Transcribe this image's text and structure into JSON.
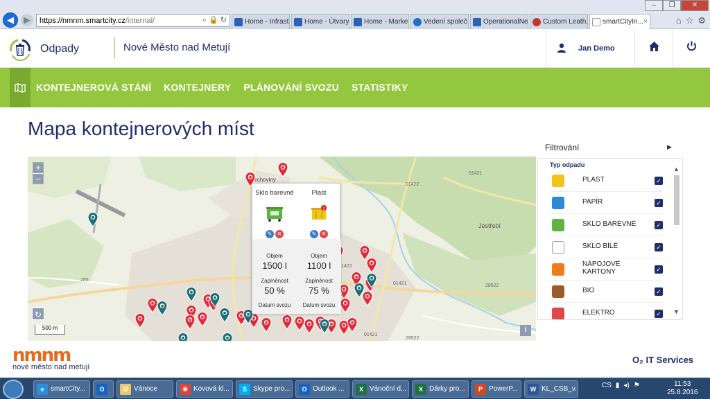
{
  "browser": {
    "url_domain": "https://nmnm.smartcity.cz",
    "url_path": "/internal/",
    "tabs": [
      {
        "label": "Home - Infrast...",
        "active": false
      },
      {
        "label": "Home - Útvary...",
        "active": false
      },
      {
        "label": "Home - Marke...",
        "active": false
      },
      {
        "label": "Vedení společ...",
        "active": false
      },
      {
        "label": "OperationalNe...",
        "active": false
      },
      {
        "label": "Custom Leath...",
        "active": false
      },
      {
        "label": "smartCityIn...",
        "active": true
      }
    ],
    "tab_close": "×",
    "win_min": "–",
    "win_max": "❐",
    "win_close": "✕"
  },
  "header": {
    "app_name": "Odpady",
    "city": "Nové Město nad Metují",
    "user": "Jan Demo"
  },
  "nav": {
    "items": [
      "KONTEJNEROVÁ STÁNÍ",
      "KONTEJNERY",
      "PLÁNOVÁNÍ SVOZU",
      "STATISTIKY"
    ]
  },
  "main": {
    "title": "Mapa kontejnerových míst"
  },
  "map": {
    "zoom_in": "+",
    "zoom_out": "–",
    "scale": "500 m",
    "info": "i",
    "place_labels": [
      "Vrchoviny",
      "Jestřebí"
    ],
    "road_labels": [
      "01422",
      "01421",
      "01422",
      "28522",
      "285",
      "28522",
      "01421",
      "01421"
    ],
    "popup": {
      "containers": [
        {
          "type": "Sklo barevné",
          "bin_color": "#5fb342",
          "volume_label": "Objem",
          "volume": "1500 l",
          "fill_label": "Zaplněnost",
          "fill": "50 %",
          "pickup_label": "Datum svozu",
          "alert": false
        },
        {
          "type": "Plast",
          "bin_color": "#f2c318",
          "volume_label": "Objem",
          "volume": "1100 l",
          "fill_label": "Zaplněnost",
          "fill": "75 %",
          "pickup_label": "Datum svozu",
          "alert": true
        }
      ]
    }
  },
  "filter": {
    "title": "Filtrování",
    "subtitle": "Typ odpadu",
    "items": [
      {
        "label": "PLAST",
        "color": "#f2c318",
        "checked": true
      },
      {
        "label": "PAPÍR",
        "color": "#2a8bd6",
        "checked": true
      },
      {
        "label": "SKLO BAREVNÉ",
        "color": "#5fb342",
        "checked": true
      },
      {
        "label": "SKLO BÍLÉ",
        "color": "#ffffff",
        "checked": true
      },
      {
        "label": "NÁPOJOVÉ KARTONY",
        "color": "#f07b1e",
        "checked": true
      },
      {
        "label": "BIO",
        "color": "#9c5b2b",
        "checked": true
      },
      {
        "label": "ELEKTRO",
        "color": "#e04848",
        "checked": true
      }
    ],
    "check": "✓"
  },
  "footer": {
    "logo_mark": "nmnm",
    "logo_text": "nové město nad metují",
    "partner": "O₂ IT Services"
  },
  "taskbar": {
    "items": [
      {
        "label": "smartCity...",
        "icon": "e",
        "icon_color": "#2b8fe0",
        "width": 82
      },
      {
        "label": "",
        "icon": "O",
        "icon_color": "#1565c0",
        "width": 30
      },
      {
        "label": "Vánoce",
        "icon": "▤",
        "icon_color": "#e9c86a",
        "width": 82
      },
      {
        "label": "Kovová kl...",
        "icon": "◉",
        "icon_color": "#db4437",
        "width": 82
      },
      {
        "label": "Skype pro...",
        "icon": "S",
        "icon_color": "#00aff0",
        "width": 82
      },
      {
        "label": "Outlook ...",
        "icon": "O",
        "icon_color": "#1565c0",
        "width": 78
      },
      {
        "label": "Vánoční d...",
        "icon": "X",
        "icon_color": "#1e7145",
        "width": 82
      },
      {
        "label": "Dárky pro...",
        "icon": "X",
        "icon_color": "#1e7145",
        "width": 82
      },
      {
        "label": "PowerP...",
        "icon": "P",
        "icon_color": "#d24726",
        "width": 72
      },
      {
        "label": "KL_CSB_v...",
        "icon": "W",
        "icon_color": "#2b579a",
        "width": 78
      }
    ],
    "lang": "CS",
    "time": "11:53",
    "date": "25.8.2016"
  }
}
